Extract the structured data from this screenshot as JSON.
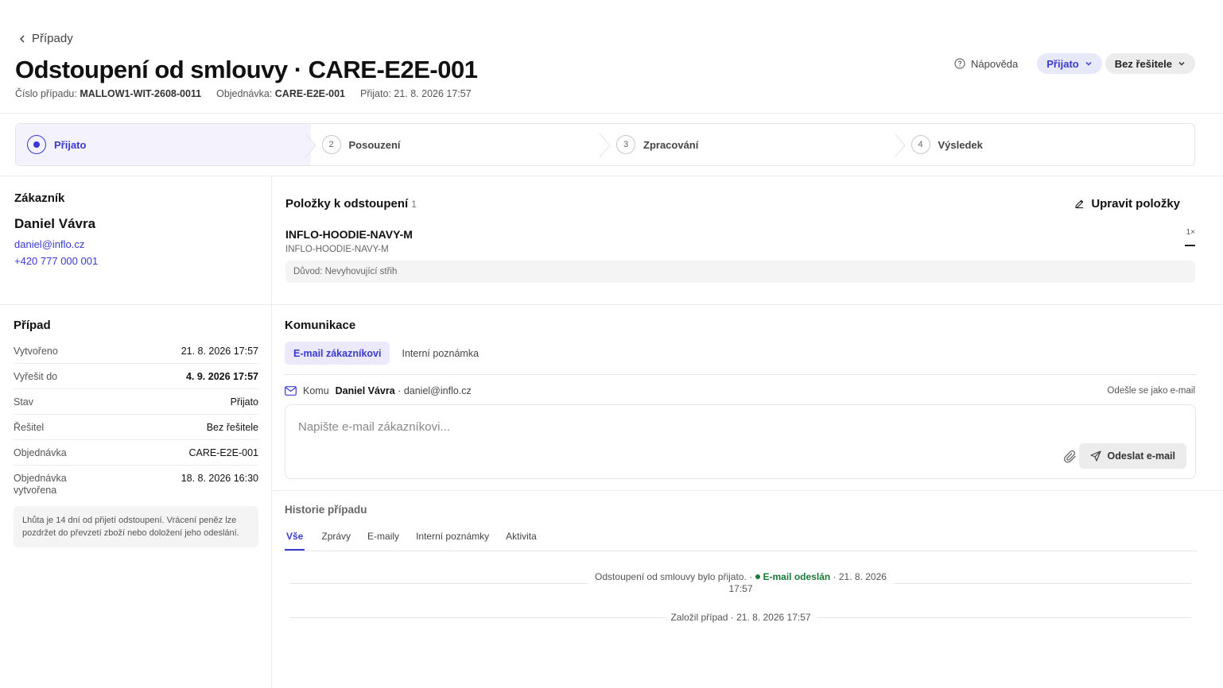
{
  "header": {
    "back_label": "Případy",
    "title": "Odstoupení od smlouvy · CARE-E2E-001",
    "meta": {
      "case_number_label": "Číslo případu:",
      "case_number": "MALLOW1-WIT-2608-0011",
      "order_label": "Objednávka:",
      "order": "CARE-E2E-001",
      "received_label": "Přijato:",
      "received": "21. 8. 2026 17:57"
    },
    "help_label": "Nápověda",
    "status_label": "Přijato",
    "assignee_label": "Bez řešitele"
  },
  "stepper": {
    "steps": [
      {
        "num": "1",
        "label": "Přijato"
      },
      {
        "num": "2",
        "label": "Posouzení"
      },
      {
        "num": "3",
        "label": "Zpracování"
      },
      {
        "num": "4",
        "label": "Výsledek"
      }
    ],
    "active_index": 0
  },
  "customer": {
    "section_label": "Zákazník",
    "name": "Daniel Vávra",
    "email": "daniel@inflo.cz",
    "phone": "+420 777 000 001"
  },
  "case": {
    "section_label": "Případ",
    "rows": [
      {
        "key": "Vytvořeno",
        "value": "21. 8. 2026 17:57"
      },
      {
        "key": "Vyřešit do",
        "value": "4. 9. 2026 17:57"
      },
      {
        "key": "Stav",
        "value": "Přijato"
      },
      {
        "key": "Řešitel",
        "value": "Bez řešitele"
      },
      {
        "key": "Objednávka",
        "value": "CARE-E2E-001"
      },
      {
        "key": "Objednávka vytvořena",
        "value": "18. 8. 2026 16:30"
      }
    ],
    "note": "Lhůta je 14 dní od přijetí odstoupení. Vrácení peněz lze pozdržet do převzetí zboží nebo doložení jeho odeslání."
  },
  "items": {
    "title": "Položky k odstoupení",
    "count": "1",
    "edit_label": "Upravit položky",
    "list": [
      {
        "name": "INFLO-HOODIE-NAVY-M",
        "sku": "INFLO-HOODIE-NAVY-M",
        "qty": "1×",
        "reason": "Důvod: Nevyhovující střih"
      }
    ]
  },
  "communication": {
    "title": "Komunikace",
    "tabs": [
      "E-mail zákazníkovi",
      "Interní poznámka"
    ],
    "to_label": "Komu",
    "to_name": "Daniel Vávra",
    "to_email": "· daniel@inflo.cz",
    "send_note": "Odešle se jako e-mail",
    "placeholder": "Napište e-mail zákazníkovi...",
    "send_label": "Odeslat e-mail"
  },
  "history": {
    "title": "Historie případu",
    "tabs": [
      "Vše",
      "Zprávy",
      "E-maily",
      "Interní poznámky",
      "Aktivita"
    ],
    "events": [
      {
        "text": "Odstoupení od smlouvy bylo přijato. ·",
        "badge": "E-mail odeslán",
        "time": "· 21. 8. 2026 17:57"
      },
      {
        "text": "Založil případ · 21. 8. 2026 17:57"
      }
    ]
  },
  "colors": {
    "accent": "#3a3ad0",
    "accent_bg": "#ebe9fb",
    "success": "#1b7a3a"
  }
}
